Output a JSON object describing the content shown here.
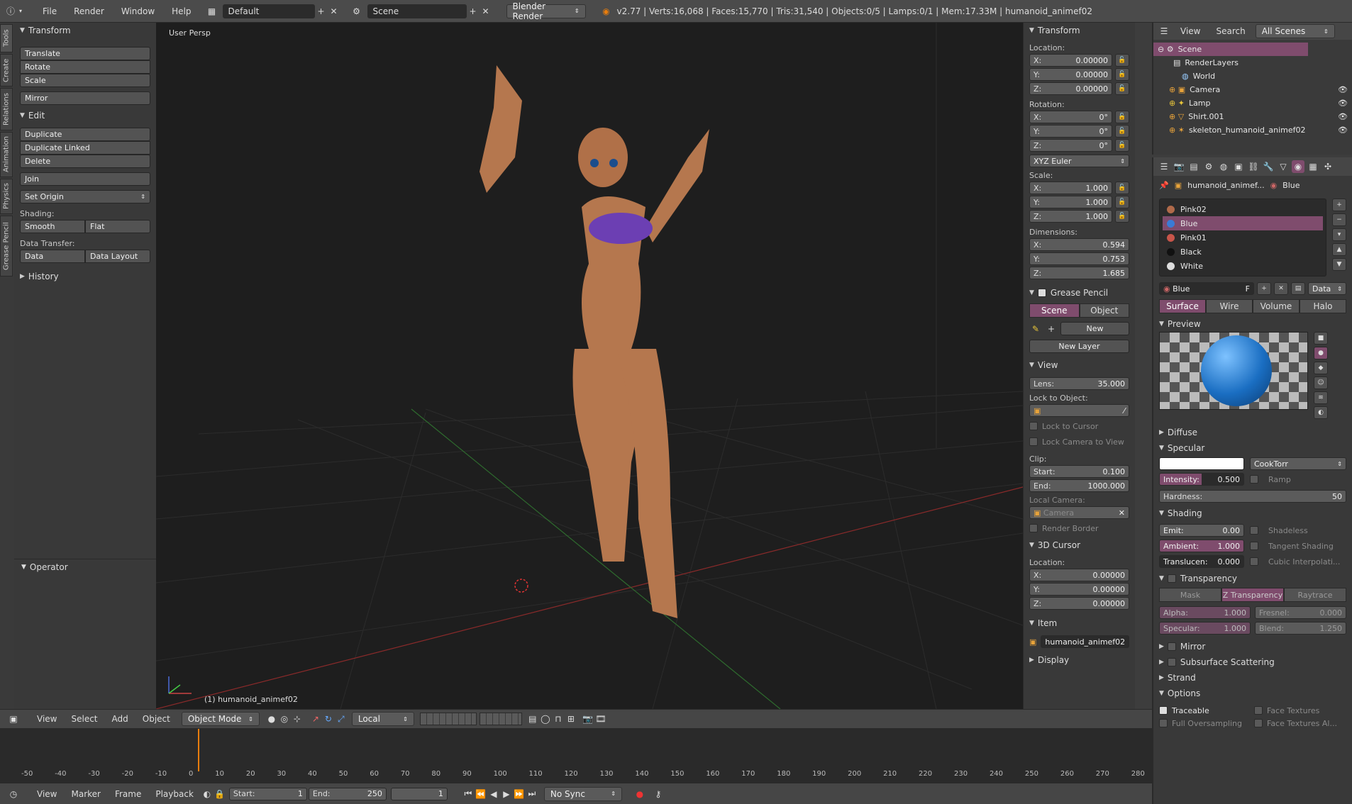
{
  "topbar": {
    "menus": [
      "File",
      "Render",
      "Window",
      "Help"
    ],
    "layout": "Default",
    "scene": "Scene",
    "engine": "Blender Render",
    "stats": "v2.77 | Verts:16,068 | Faces:15,770 | Tris:31,540 | Objects:0/5 | Lamps:0/1 | Mem:17.33M | humanoid_animef02"
  },
  "vtabs": [
    "Tools",
    "Create",
    "Relations",
    "Animation",
    "Physics",
    "Grease Pencil"
  ],
  "tools": {
    "transform_header": "Transform",
    "translate": "Translate",
    "rotate": "Rotate",
    "scale": "Scale",
    "mirror": "Mirror",
    "edit_header": "Edit",
    "duplicate": "Duplicate",
    "duplicate_linked": "Duplicate Linked",
    "delete": "Delete",
    "join": "Join",
    "set_origin": "Set Origin",
    "shading_label": "Shading:",
    "smooth": "Smooth",
    "flat": "Flat",
    "data_transfer_label": "Data Transfer:",
    "data": "Data",
    "data_layout": "Data Layout",
    "history": "History",
    "operator": "Operator"
  },
  "viewport": {
    "label": "User Persp",
    "object_label": "(1) humanoid_animef02"
  },
  "viewport_header": {
    "menus": [
      "View",
      "Select",
      "Add",
      "Object"
    ],
    "mode": "Object Mode",
    "orientation": "Local"
  },
  "props": {
    "transform": "Transform",
    "location_label": "Location:",
    "loc": {
      "x": "0.00000",
      "y": "0.00000",
      "z": "0.00000"
    },
    "rotation_label": "Rotation:",
    "rot": {
      "x": "0°",
      "y": "0°",
      "z": "0°"
    },
    "euler": "XYZ Euler",
    "scale_label": "Scale:",
    "scale": {
      "x": "1.000",
      "y": "1.000",
      "z": "1.000"
    },
    "dimensions_label": "Dimensions:",
    "dim": {
      "x": "0.594",
      "y": "0.753",
      "z": "1.685"
    },
    "grease_pencil": "Grease Pencil",
    "gp_scene": "Scene",
    "gp_object": "Object",
    "gp_new": "New",
    "gp_new_layer": "New Layer",
    "view": "View",
    "lens_label": "Lens:",
    "lens": "35.000",
    "lock_to_object": "Lock to Object:",
    "lock_to_cursor": "Lock to Cursor",
    "lock_camera": "Lock Camera to View",
    "clip_label": "Clip:",
    "clip_start_label": "Start:",
    "clip_start": "0.100",
    "clip_end_label": "End:",
    "clip_end": "1000.000",
    "local_camera": "Local Camera:",
    "camera": "Camera",
    "render_border": "Render Border",
    "cursor": "3D Cursor",
    "cursor_location": "Location:",
    "cur": {
      "x": "0.00000",
      "y": "0.00000",
      "z": "0.00000"
    },
    "item": "Item",
    "item_name": "humanoid_animef02",
    "display": "Display",
    "x": "X:",
    "y": "Y:",
    "z": "Z:"
  },
  "outliner": {
    "menus": [
      "View",
      "Search"
    ],
    "scenes": "All Scenes",
    "items": [
      "Scene",
      "RenderLayers",
      "World",
      "Camera",
      "Lamp",
      "Shirt.001",
      "skeleton_humanoid_animef02"
    ]
  },
  "material": {
    "object": "humanoid_animef...",
    "material": "Blue",
    "slots": [
      "Pink02",
      "Blue",
      "Pink01",
      "Black",
      "White"
    ],
    "slot_colors": [
      "#b06a4a",
      "#3a7bd5",
      "#c8554a",
      "#111111",
      "#dddddd"
    ],
    "name": "Blue",
    "f": "F",
    "data": "Data",
    "tabs": [
      "Surface",
      "Wire",
      "Volume",
      "Halo"
    ],
    "preview": "Preview",
    "diffuse": "Diffuse",
    "specular": "Specular",
    "shader": "CookTorr",
    "intensity_label": "Intensity:",
    "intensity": "0.500",
    "ramp": "Ramp",
    "hardness_label": "Hardness:",
    "hardness": "50",
    "shading": "Shading",
    "emit_label": "Emit:",
    "emit": "0.00",
    "shadeless": "Shadeless",
    "ambient_label": "Ambient:",
    "ambient": "1.000",
    "tangent": "Tangent Shading",
    "translucen_label": "Translucen:",
    "translucen": "0.000",
    "cubic": "Cubic Interpolati...",
    "transparency": "Transparency",
    "mask": "Mask",
    "ztrans": "Z Transparency",
    "raytrace": "Raytrace",
    "alpha_label": "Alpha:",
    "alpha": "1.000",
    "fresnel_label": "Fresnel:",
    "fresnel": "0.000",
    "spec_label": "Specular:",
    "spec": "1.000",
    "blend_label": "Blend:",
    "blend": "1.250",
    "mirror": "Mirror",
    "sss": "Subsurface Scattering",
    "strand": "Strand",
    "options": "Options",
    "traceable": "Traceable",
    "face_textures": "Face Textures",
    "full_os": "Full Oversampling",
    "face_textures_al": "Face Textures Al..."
  },
  "timeline": {
    "ticks": [
      "-50",
      "-40",
      "-30",
      "-20",
      "-10",
      "0",
      "10",
      "20",
      "30",
      "40",
      "50",
      "60",
      "70",
      "80",
      "90",
      "100",
      "110",
      "120",
      "130",
      "140",
      "150",
      "160",
      "170",
      "180",
      "190",
      "200",
      "210",
      "220",
      "230",
      "240",
      "250",
      "260",
      "270",
      "280"
    ],
    "menus": [
      "View",
      "Marker",
      "Frame",
      "Playback"
    ],
    "start_label": "Start:",
    "start": "1",
    "end_label": "End:",
    "end": "250",
    "frame": "1",
    "sync": "No Sync"
  }
}
